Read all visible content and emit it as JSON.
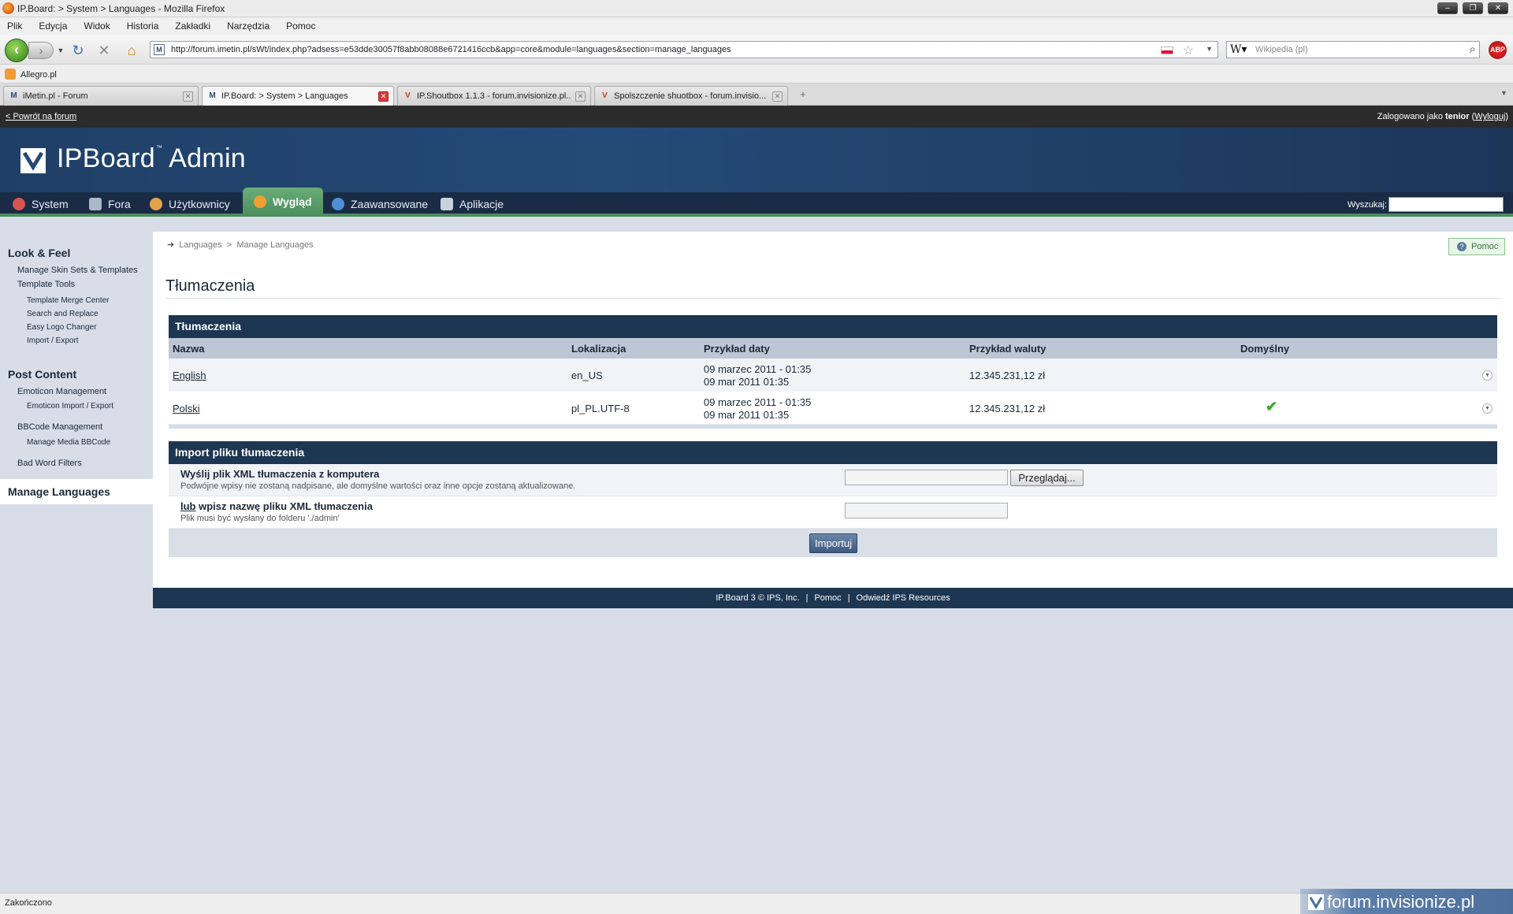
{
  "browser": {
    "window_title": "IP.Board: > System > Languages - Mozilla Firefox",
    "menu": [
      "Plik",
      "Edycja",
      "Widok",
      "Historia",
      "Zakładki",
      "Narzędzia",
      "Pomoc"
    ],
    "url": "http://forum.imetin.pl/sWt/index.php?adsess=e53dde30057f8abb08088e6721416ccb&app=core&module=languages&section=manage_languages",
    "search_placeholder": "Wikipedia (pl)",
    "bookmark": "Allegro.pl",
    "tabs": [
      {
        "label": "iMetin.pl - Forum",
        "active": false
      },
      {
        "label": "IP.Board: > System > Languages",
        "active": true
      },
      {
        "label": "IP.Shoutbox 1.1.3 - forum.invisionize.pl...",
        "active": false
      },
      {
        "label": "Spolszczenie shuotbox - forum.invisio...",
        "active": false
      }
    ],
    "status": "Zakończono"
  },
  "admin": {
    "back_link": "< Powrót na forum",
    "login_prefix": "Zalogowano jako",
    "user": "tenior",
    "logout": "Wyloguj",
    "logo_name": "IPBoard",
    "logo_tm": "™",
    "logo_admin": "Admin",
    "nav": [
      {
        "label": "System",
        "icon": "system-icon",
        "color": "#d9534f"
      },
      {
        "label": "Fora",
        "icon": "forums-icon",
        "color": "#aab8c8"
      },
      {
        "label": "Użytkownicy",
        "icon": "users-icon",
        "color": "#e3a34b"
      },
      {
        "label": "Wygląd",
        "icon": "look-icon",
        "color": "#f0a030"
      },
      {
        "label": "Zaawansowane",
        "icon": "advanced-icon",
        "color": "#4f8fd8"
      },
      {
        "label": "Aplikacje",
        "icon": "apps-icon",
        "color": "#c9d2dc"
      }
    ],
    "search_label": "Wyszukaj:"
  },
  "sidebar": {
    "section1": "Look & Feel",
    "items1": [
      "Manage Skin Sets & Templates",
      "Template Tools"
    ],
    "sub1": [
      "Template Merge Center",
      "Search and Replace",
      "Easy Logo Changer",
      "Import / Export"
    ],
    "section2": "Post Content",
    "emoticon": "Emoticon Management",
    "emoticon_sub": "Emoticon Import / Export",
    "bbcode": "BBCode Management",
    "bbcode_sub": "Manage Media BBCode",
    "badword": "Bad Word Filters",
    "active": "Manage Languages"
  },
  "content": {
    "breadcrumb": [
      "Languages",
      "Manage Languages"
    ],
    "breadcrumb_sep": ">",
    "help": "Pomoc",
    "title": "Tłumaczenia",
    "table_title": "Tłumaczenia",
    "columns": [
      "Nazwa",
      "Lokalizacja",
      "Przykład daty",
      "Przykład waluty",
      "Domyślny"
    ],
    "rows": [
      {
        "name": "English",
        "locale": "en_US",
        "date1": "09 marzec 2011 - 01:35",
        "date2": "09 mar 2011 01:35",
        "currency": "12.345.231,12 zł",
        "default": false
      },
      {
        "name": "Polski",
        "locale": "pl_PL.UTF-8",
        "date1": "09 marzec 2011 - 01:35",
        "date2": "09 mar 2011 01:35",
        "currency": "12.345.231,12 zł",
        "default": true
      }
    ],
    "import_title": "Import pliku tłumaczenia",
    "import_file_label": "Wyślij plik XML tłumaczenia z komputera",
    "import_file_hint": "Podwójne wpisy nie zostaną nadpisane, ale domyślne wartości oraz inne opcje zostaną aktualizowane.",
    "browse": "Przeglądaj...",
    "import_name_or": "lub",
    "import_name_label": "wpisz nazwę pliku XML tłumaczenia",
    "import_name_hint": "Plik musi być wysłany do folderu './admin'",
    "import_button": "Importuj"
  },
  "footer": {
    "copyright": "IP.Board 3 © IPS, Inc.",
    "help": "Pomoc",
    "resources": "Odwiedź IPS Resources",
    "sep": "|"
  },
  "watermark": "forum.invisionize.pl"
}
